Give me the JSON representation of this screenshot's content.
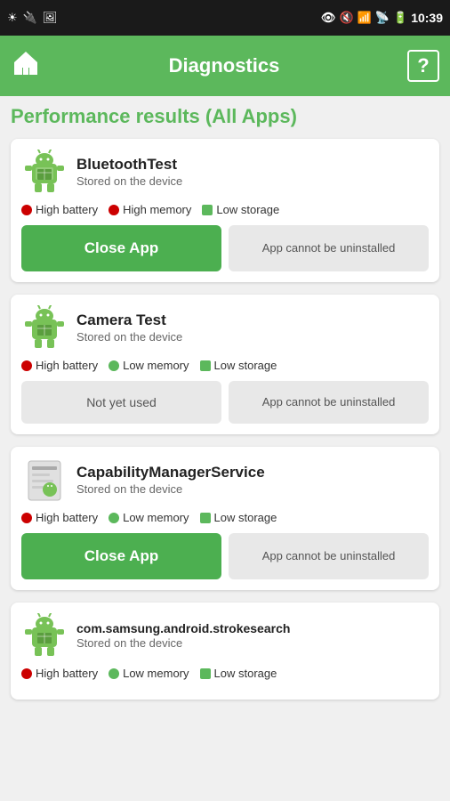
{
  "statusBar": {
    "time": "10:39"
  },
  "navBar": {
    "title": "Diagnostics",
    "homeIcon": "🏠",
    "helpIcon": "?"
  },
  "pageTitle": "Performance results (All Apps)",
  "apps": [
    {
      "id": "bluetooth",
      "name": "BluetoothTest",
      "subtitle": "Stored on the device",
      "metrics": [
        {
          "label": "High battery",
          "dotType": "red"
        },
        {
          "label": "High memory",
          "dotType": "red"
        },
        {
          "label": "Low storage",
          "dotType": "green-sq"
        }
      ],
      "primaryAction": "Close App",
      "primaryType": "close",
      "secondaryAction": "App cannot be uninstalled",
      "secondaryType": "cannot"
    },
    {
      "id": "camera",
      "name": "Camera Test",
      "subtitle": "Stored on the device",
      "metrics": [
        {
          "label": "High battery",
          "dotType": "red"
        },
        {
          "label": "Low memory",
          "dotType": "green"
        },
        {
          "label": "Low storage",
          "dotType": "green-sq"
        }
      ],
      "primaryAction": "Not yet used",
      "primaryType": "notused",
      "secondaryAction": "App cannot be uninstalled",
      "secondaryType": "cannot"
    },
    {
      "id": "capability",
      "name": "CapabilityManagerService",
      "subtitle": "Stored on the device",
      "metrics": [
        {
          "label": "High battery",
          "dotType": "red"
        },
        {
          "label": "Low memory",
          "dotType": "green"
        },
        {
          "label": "Low storage",
          "dotType": "green-sq"
        }
      ],
      "primaryAction": "Close App",
      "primaryType": "close",
      "secondaryAction": "App cannot be uninstalled",
      "secondaryType": "cannot"
    },
    {
      "id": "strokesearch",
      "name": "com.samsung.android.strokesearch",
      "subtitle": "Stored on the device",
      "metrics": [
        {
          "label": "High battery",
          "dotType": "red"
        },
        {
          "label": "Low memory",
          "dotType": "green"
        },
        {
          "label": "Low storage",
          "dotType": "green-sq"
        }
      ],
      "primaryAction": null,
      "secondaryAction": null
    }
  ]
}
